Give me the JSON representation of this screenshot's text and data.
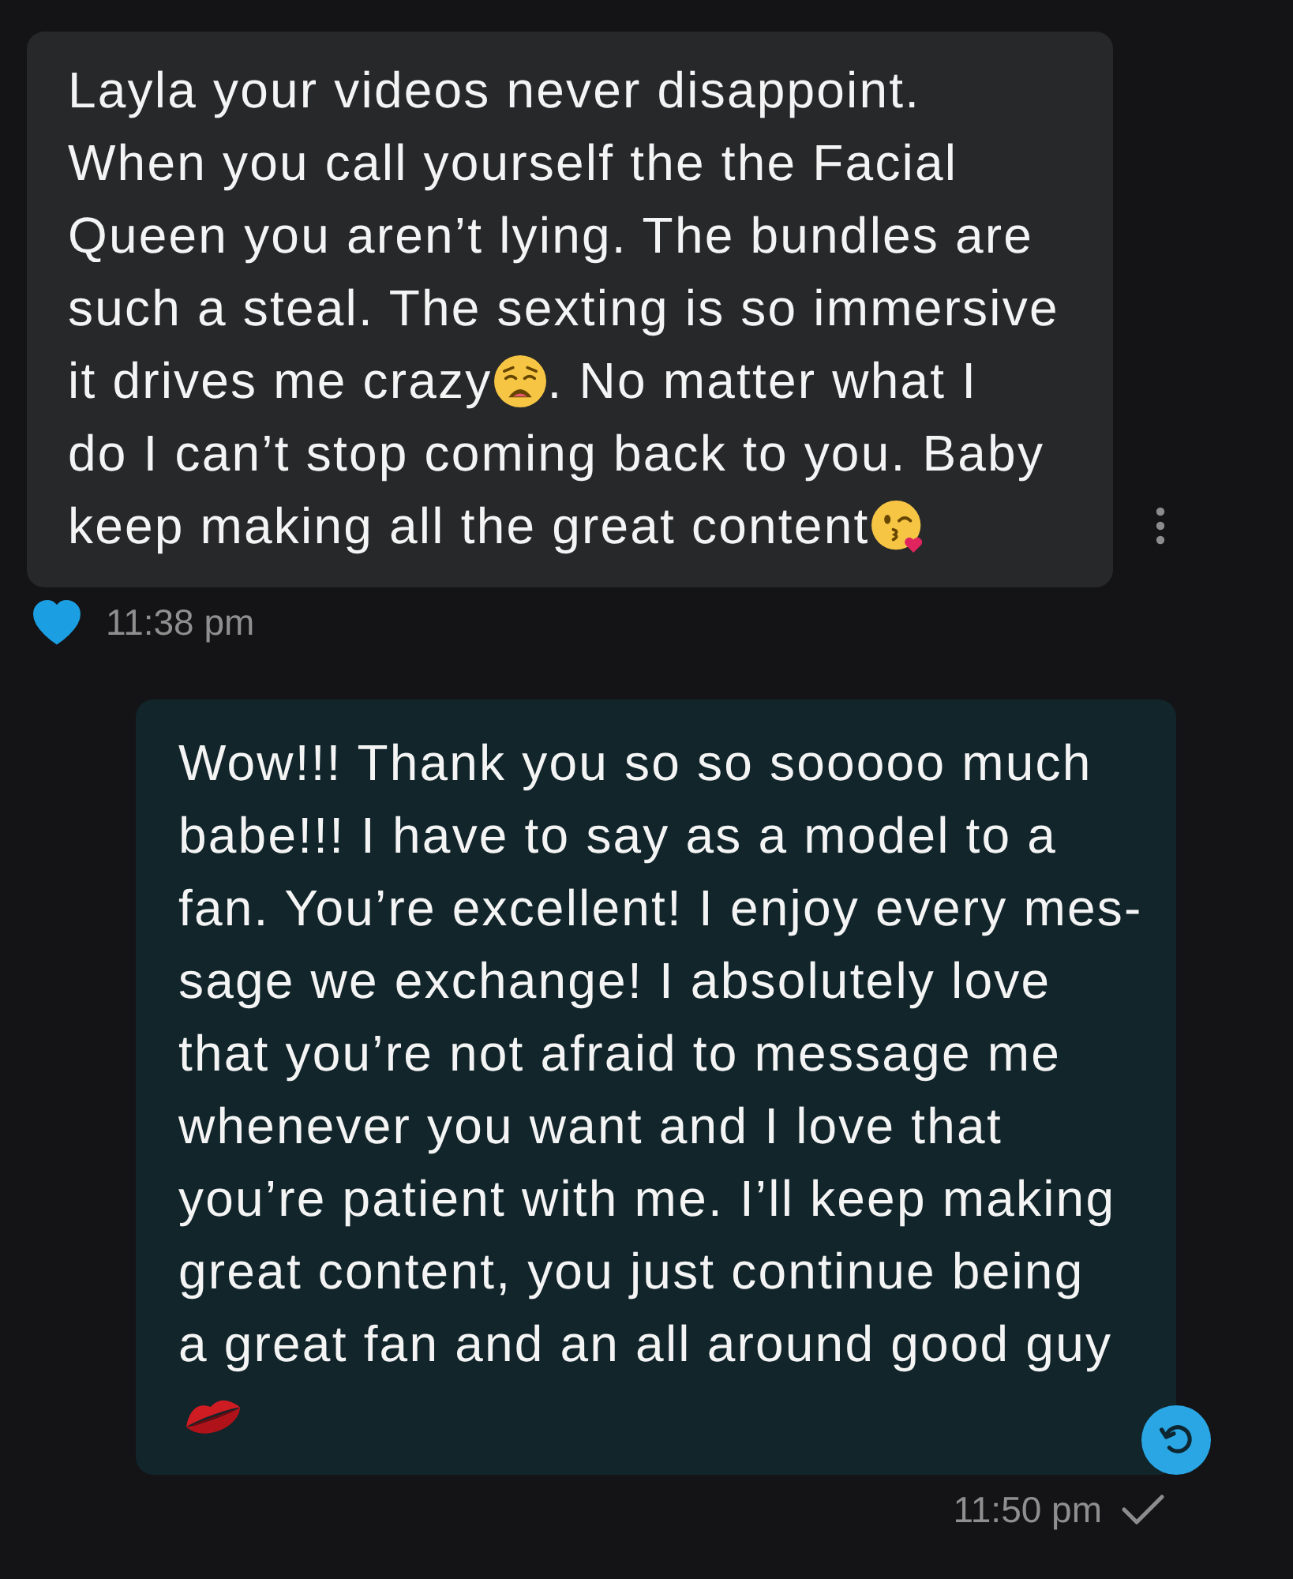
{
  "messages": [
    {
      "kind": "received",
      "lines": [
        [
          {
            "kind": "text",
            "text": "Layla your videos never disappoint."
          }
        ],
        [
          {
            "kind": "text",
            "text": "When you call yourself the the Facial"
          }
        ],
        [
          {
            "kind": "text",
            "text": "Queen you aren’t lying. The bundles are"
          }
        ],
        [
          {
            "kind": "text",
            "text": "such a steal. The sexting is so immersive"
          }
        ],
        [
          {
            "kind": "text",
            "text": "it drives me crazy"
          },
          {
            "kind": "weary"
          },
          {
            "kind": "text",
            "text": ". No matter what I"
          }
        ],
        [
          {
            "kind": "text",
            "text": "do I can’t stop coming back to you. Baby"
          }
        ],
        [
          {
            "kind": "text",
            "text": "keep making all the great content"
          },
          {
            "kind": "kiss"
          }
        ]
      ],
      "liked": true,
      "time": "11:38 pm"
    },
    {
      "kind": "sent",
      "lines": [
        [
          {
            "kind": "text",
            "text": "Wow!!! Thank you so so sooooo much"
          }
        ],
        [
          {
            "kind": "text",
            "text": "babe!!! I have to say as a model to a"
          }
        ],
        [
          {
            "kind": "text",
            "text": "fan. You’re excellent! I enjoy every mes-"
          }
        ],
        [
          {
            "kind": "text",
            "text": "sage we exchange! I absolutely love"
          }
        ],
        [
          {
            "kind": "text",
            "text": "that you’re not afraid to message me"
          }
        ],
        [
          {
            "kind": "text",
            "text": "whenever you want and I love that"
          }
        ],
        [
          {
            "kind": "text",
            "text": "you’re patient with me. I’ll keep making"
          }
        ],
        [
          {
            "kind": "text",
            "text": "great content, you just continue being"
          }
        ],
        [
          {
            "kind": "text",
            "text": "a great fan and an all around good guy"
          }
        ],
        [
          {
            "kind": "lips"
          }
        ]
      ],
      "time": "11:50 pm"
    }
  ]
}
